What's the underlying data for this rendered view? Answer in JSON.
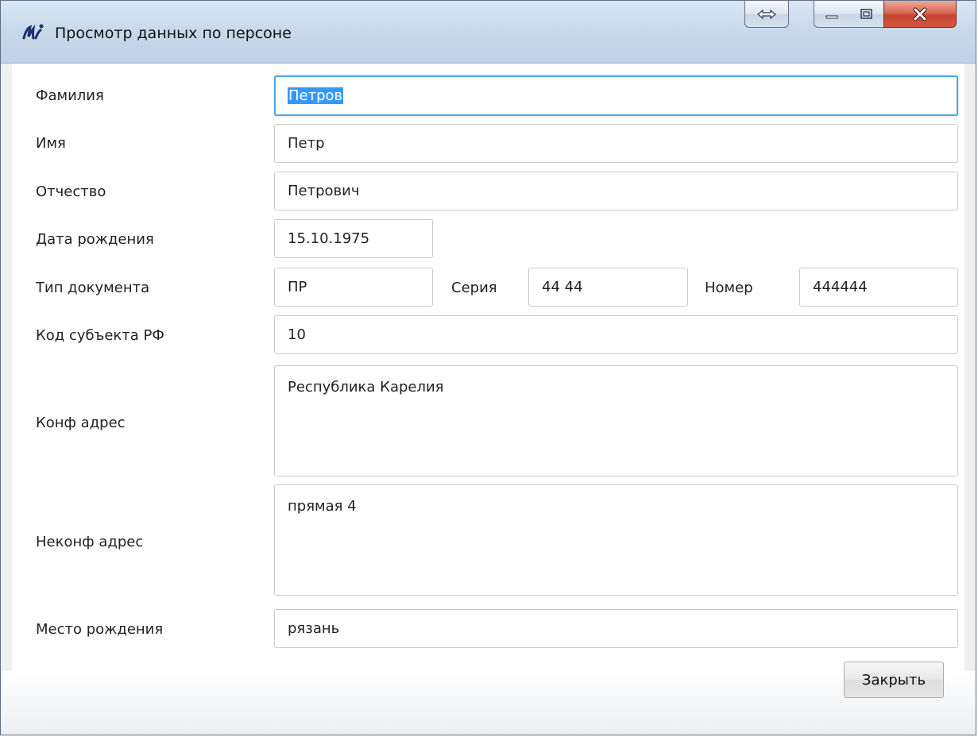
{
  "window": {
    "title": "Просмотр данных по персоне"
  },
  "icons": {
    "app": "app-logo-icon",
    "resize": "resize-horizontal-icon",
    "minimize": "minimize-icon",
    "maximize": "maximize-icon",
    "close": "close-icon"
  },
  "form": {
    "surname": {
      "label": "Фамилия",
      "value": "Петров"
    },
    "name": {
      "label": "Имя",
      "value": "Петр"
    },
    "patronymic": {
      "label": "Отчество",
      "value": "Петрович"
    },
    "birth_date": {
      "label": "Дата рождения",
      "value": "15.10.1975"
    },
    "document": {
      "type_label": "Тип документа",
      "type_value": "ПР",
      "series_label": "Серия",
      "series_value": "44 44",
      "number_label": "Номер",
      "number_value": "444444"
    },
    "region_code": {
      "label": "Код субъекта РФ",
      "value": "10"
    },
    "conf_address": {
      "label": "Конф адрес",
      "value": "Республика Карелия"
    },
    "nonconf_address": {
      "label": "Неконф адрес",
      "value": "прямая 4"
    },
    "birth_place": {
      "label": "Место рождения",
      "value": "рязань"
    }
  },
  "footer": {
    "close_label": "Закрыть"
  },
  "colors": {
    "focus_border": "#4aa6e8",
    "selection": "#3399ff",
    "close_button_red": "#c7462e"
  }
}
